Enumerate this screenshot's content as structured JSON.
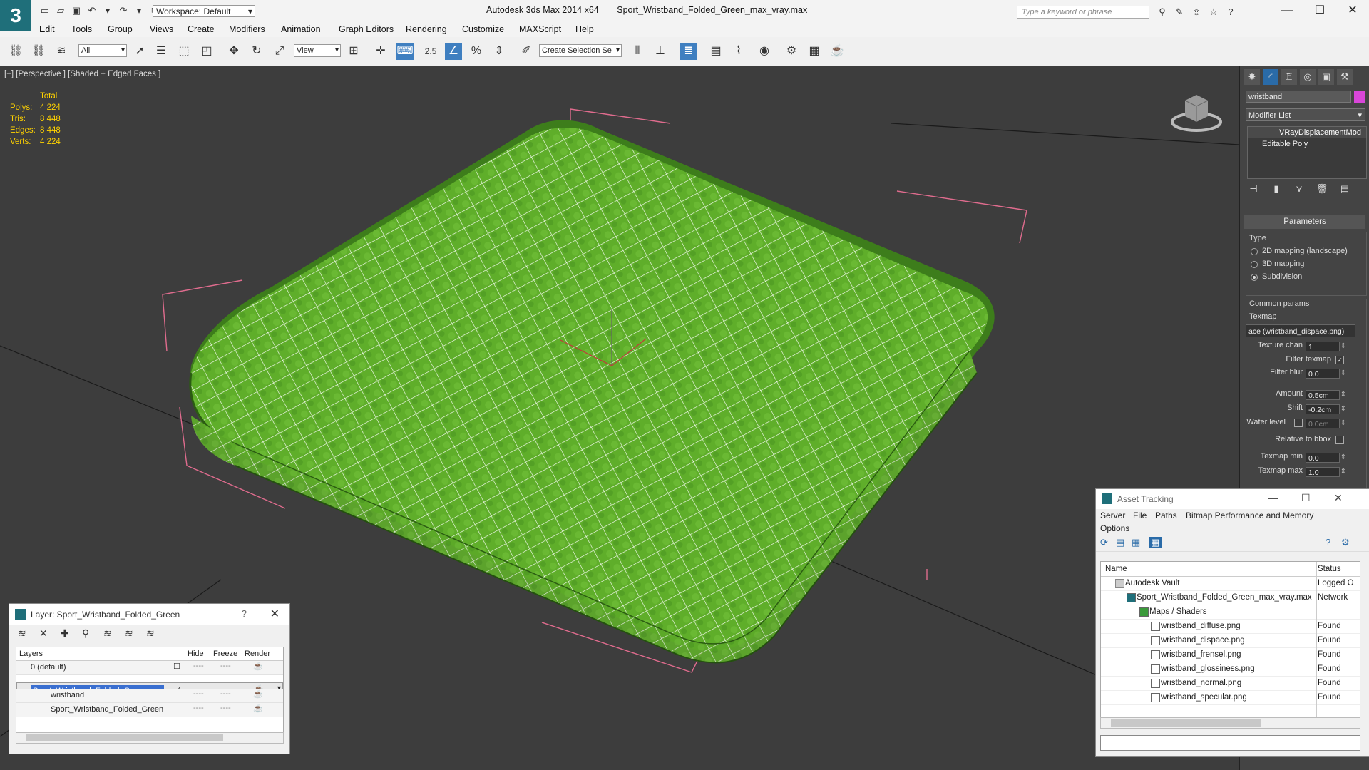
{
  "app": {
    "title": "Autodesk 3ds Max  2014 x64",
    "file": "Sport_Wristband_Folded_Green_max_vray.max",
    "workspace": "Workspace: Default",
    "search_placeholder": "Type a keyword or phrase"
  },
  "menu": [
    "Edit",
    "Tools",
    "Group",
    "Views",
    "Create",
    "Modifiers",
    "Animation",
    "Graph Editors",
    "Rendering",
    "Customize",
    "MAXScript",
    "Help"
  ],
  "toolbar": {
    "filter": "All",
    "ref_coord": "View",
    "snap_value": "2.5",
    "selection_set": "Create Selection Se"
  },
  "viewport": {
    "label": "[+] [Perspective ] [Shaded + Edged Faces ]",
    "stats": {
      "header": "Total",
      "rows": [
        {
          "k": "Polys:",
          "v": "4 224"
        },
        {
          "k": "Tris:",
          "v": "8 448"
        },
        {
          "k": "Edges:",
          "v": "8 448"
        },
        {
          "k": "Verts:",
          "v": "4 224"
        }
      ]
    }
  },
  "command_panel": {
    "object_name": "wristband",
    "object_color": "#d946d9",
    "modifier_list": "Modifier List",
    "stack": [
      "VRayDisplacementMod",
      "Editable Poly"
    ],
    "rollout": "Parameters",
    "type_label": "Type",
    "type_options": [
      "2D mapping (landscape)",
      "3D mapping",
      "Subdivision"
    ],
    "type_selected": 2,
    "common_params": "Common params",
    "texmap_label": "Texmap",
    "texmap_value": "ace (wristband_dispace.png)",
    "texture_chan_label": "Texture chan",
    "texture_chan": "1",
    "filter_texmap_label": "Filter texmap",
    "filter_blur_label": "Filter blur",
    "filter_blur": "0.0",
    "amount_label": "Amount",
    "amount": "0.5cm",
    "shift_label": "Shift",
    "shift": "-0.2cm",
    "water_level_label": "Water level",
    "water_level": "0.0cm",
    "relative_bbox_label": "Relative to bbox",
    "texmap_min_label": "Texmap min",
    "texmap_min": "0.0",
    "texmap_max_label": "Texmap max",
    "texmap_max": "1.0"
  },
  "layer_window": {
    "title": "Layer: Sport_Wristband_Folded_Green",
    "help": "?",
    "columns": [
      "Layers",
      "Hide",
      "Freeze",
      "Render"
    ],
    "rows": [
      {
        "name": "0 (default)",
        "indent": 0
      },
      {
        "name": "Sport_Wristband_Folded_Green",
        "indent": 0,
        "selected": true
      },
      {
        "name": "wristband",
        "indent": 1
      },
      {
        "name": "Sport_Wristband_Folded_Green",
        "indent": 1
      }
    ],
    "dash": "----"
  },
  "asset_tracking": {
    "title": "Asset Tracking",
    "menu": [
      "Server",
      "File",
      "Paths",
      "Bitmap Performance and Memory",
      "Options"
    ],
    "columns": [
      "Name",
      "Status"
    ],
    "rows": [
      {
        "name": "Autodesk Vault",
        "status": "Logged O",
        "indent": 1
      },
      {
        "name": "Sport_Wristband_Folded_Green_max_vray.max",
        "status": "Network",
        "indent": 2
      },
      {
        "name": "Maps / Shaders",
        "status": "",
        "indent": 3
      },
      {
        "name": "wristband_diffuse.png",
        "status": "Found",
        "indent": 4
      },
      {
        "name": "wristband_dispace.png",
        "status": "Found",
        "indent": 4
      },
      {
        "name": "wristband_frensel.png",
        "status": "Found",
        "indent": 4
      },
      {
        "name": "wristband_glossiness.png",
        "status": "Found",
        "indent": 4
      },
      {
        "name": "wristband_normal.png",
        "status": "Found",
        "indent": 4
      },
      {
        "name": "wristband_specular.png",
        "status": "Found",
        "indent": 4
      }
    ]
  }
}
